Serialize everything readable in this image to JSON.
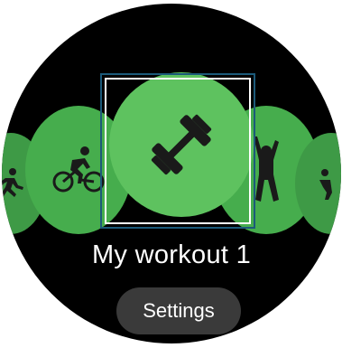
{
  "workout": {
    "title": "My workout 1"
  },
  "actions": {
    "settings_label": "Settings"
  },
  "carousel": {
    "items": [
      {
        "icon": "running-icon"
      },
      {
        "icon": "cycling-icon"
      },
      {
        "icon": "dumbbell-icon",
        "selected": true
      },
      {
        "icon": "stretching-icon"
      },
      {
        "icon": "exercise-icon"
      }
    ]
  },
  "colors": {
    "background": "#000000",
    "selected_circle": "#5ec25f",
    "side_circle": "#46ad4d",
    "icon": "#1a1a1a",
    "button_bg": "#3a3a3a",
    "focus_outline": "#1c5a7a"
  }
}
